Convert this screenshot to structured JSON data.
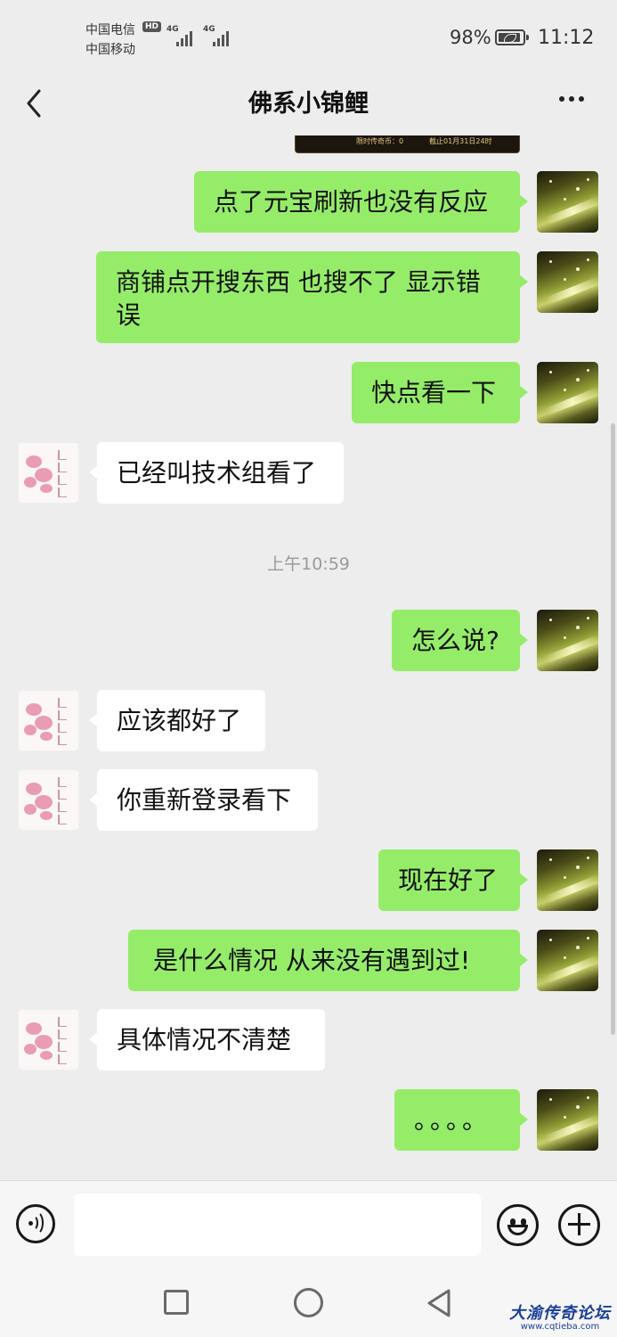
{
  "status_bar": {
    "carrier_1": "中国电信",
    "carrier_2": "中国移动",
    "hd_badge": "HD",
    "network_1": "4G",
    "network_2": "4G",
    "battery": "98%",
    "time": "11:12"
  },
  "header": {
    "title": "佛系小锦鲤",
    "back_icon": "chevron-left-icon",
    "more_icon": "more-dots-icon"
  },
  "top_image": {
    "text_left": "限时传奇币：0",
    "text_right": "截止01月31日24时"
  },
  "messages": [
    {
      "sender": "me",
      "text": "点了元宝刷新也没有反应"
    },
    {
      "sender": "me",
      "text": "商铺点开搜东西 也搜不了 显示错误"
    },
    {
      "sender": "me",
      "text": "快点看一下"
    },
    {
      "sender": "other",
      "text": "已经叫技术组看了"
    },
    {
      "sender": "timestamp",
      "text": "上午10:59"
    },
    {
      "sender": "me",
      "text": "怎么说?"
    },
    {
      "sender": "other",
      "text": "应该都好了"
    },
    {
      "sender": "other",
      "text": "你重新登录看下"
    },
    {
      "sender": "me",
      "text": "现在好了"
    },
    {
      "sender": "me",
      "text": "是什么情况 从来没有遇到过!"
    },
    {
      "sender": "other",
      "text": "具体情况不清楚"
    },
    {
      "sender": "me",
      "text": "。。。。"
    }
  ],
  "input_bar": {
    "voice_icon": "voice-icon",
    "emoji_icon": "emoji-icon",
    "plus_icon": "plus-icon",
    "text_value": ""
  },
  "nav_bar": {
    "recents_icon": "square-icon",
    "home_icon": "circle-icon",
    "back_icon": "triangle-back-icon"
  },
  "watermark": {
    "title": "大渝传奇论坛",
    "url": "www.cqtieba.com"
  },
  "colors": {
    "my_bubble": "#95ec69",
    "other_bubble": "#ffffff",
    "background": "#ededed"
  }
}
